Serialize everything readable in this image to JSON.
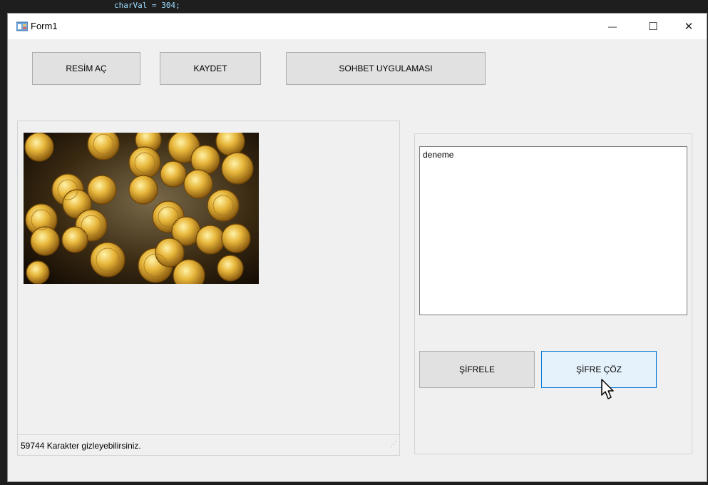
{
  "background_code": "charVal = 304;",
  "window": {
    "title": "Form1",
    "minimize_glyph": "—",
    "maximize_glyph": "☐",
    "close_glyph": "✕"
  },
  "toolbar": {
    "open_image_label": "RESİM AÇ",
    "save_label": "KAYDET",
    "chat_app_label": "SOHBET UYGULAMASI"
  },
  "image_panel": {
    "picture_icon": "gold-coins-image"
  },
  "status": {
    "text": "59744  Karakter gizleyebilirsiniz."
  },
  "message": {
    "text": "deneme"
  },
  "actions": {
    "encrypt_label": "ŞİFRELE",
    "decrypt_label": "ŞİFRE ÇÖZ"
  },
  "colors": {
    "window_bg": "#f0f0f0",
    "button_bg": "#e1e1e1",
    "hover_bg": "#e5f1fb",
    "hover_border": "#0078d7"
  }
}
